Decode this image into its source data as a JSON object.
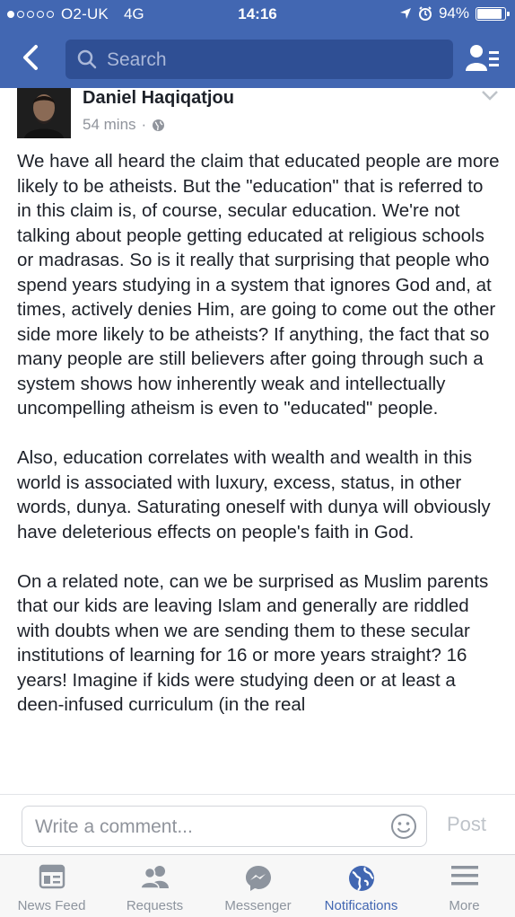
{
  "status_bar": {
    "carrier": "O2-UK",
    "network": "4G",
    "time": "14:16",
    "battery": "94%",
    "battery_level": 0.94
  },
  "nav": {
    "search_placeholder": "Search"
  },
  "post": {
    "author": "Daniel Haqiqatjou",
    "time": "54 mins",
    "separator": "·",
    "paragraphs": [
      "We have all heard the claim that educated people are more likely to be atheists. But the \"education\" that is referred to in this claim is, of course, secular education. We're not talking about people getting educated at religious schools or madrasas. So is it really that surprising that people who spend years studying in a system that ignores God and, at times, actively denies Him, are going to come out the other side more likely to be atheists? If anything, the fact that so many people are still believers after going through such a system shows how inherently weak and intellectually uncompelling atheism is even to \"educated\" people.",
      "Also, education correlates with wealth and wealth in this world is associated with luxury, excess, status, in other words, dunya. Saturating oneself with dunya will obviously have deleterious effects on people's faith in God.",
      "On a related note, can we be surprised as Muslim parents that our kids are leaving Islam and generally are riddled with doubts when we are sending them to these secular institutions of learning for 16 or more years straight? 16 years! Imagine if kids were studying deen or at least a deen-infused curriculum (in the real"
    ]
  },
  "comment": {
    "placeholder": "Write a comment...",
    "post_label": "Post"
  },
  "tabs": [
    {
      "label": "News Feed",
      "icon": "news-feed-icon"
    },
    {
      "label": "Requests",
      "icon": "friend-requests-icon"
    },
    {
      "label": "Messenger",
      "icon": "messenger-icon"
    },
    {
      "label": "Notifications",
      "icon": "globe-icon"
    },
    {
      "label": "More",
      "icon": "hamburger-icon"
    }
  ],
  "colors": {
    "brand_blue": "#4267b2",
    "search_bg": "#2f4f94",
    "inactive_tab": "#8d949e",
    "meta_gray": "#90949c"
  }
}
